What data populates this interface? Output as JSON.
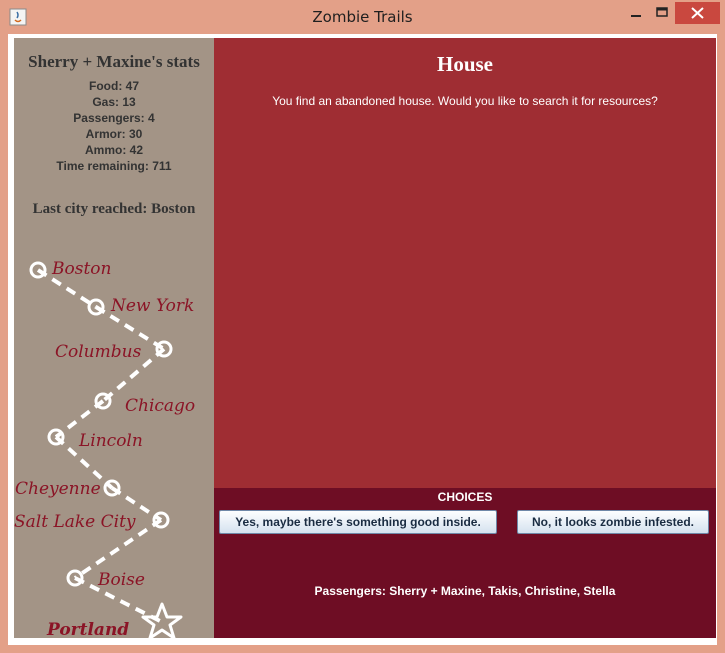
{
  "window": {
    "title": "Zombie Trails"
  },
  "stats": {
    "title": "Sherry + Maxine's stats",
    "items": [
      "Food: 47",
      "Gas: 13",
      "Passengers: 4",
      "Armor: 30",
      "Ammo: 42",
      "Time remaining: 711"
    ]
  },
  "last_city": "Last city reached: Boston",
  "map": {
    "cities": [
      "Boston",
      "New York",
      "Columbus",
      "Chicago",
      "Lincoln",
      "Cheyenne",
      "Salt Lake City",
      "Boise",
      "Portland"
    ],
    "current_city": "Boston",
    "destination_icon": "star-icon"
  },
  "event": {
    "title": "House",
    "text": "You find an abandoned house. Would you like to search it for resources?"
  },
  "choices": {
    "title": "CHOICES",
    "options": [
      "Yes, maybe there's something good inside.",
      "No, it looks zombie infested."
    ]
  },
  "passengers": "Passengers: Sherry + Maxine, Takis, Christine, Stella",
  "colors": {
    "title_bar": "#e3a088",
    "sidebar": "#a39486",
    "event_panel": "#9f2d33",
    "choices_panel": "#6e0d24",
    "city_label": "#8b1426",
    "close_button": "#c9483f"
  }
}
